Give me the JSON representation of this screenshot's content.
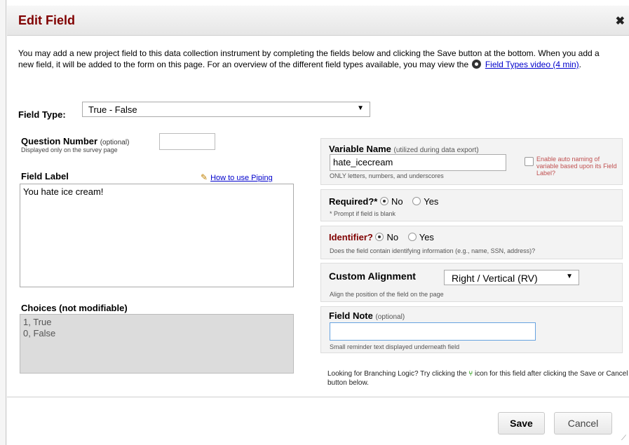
{
  "dialog": {
    "title": "Edit Field",
    "close_label": "✖"
  },
  "intro": {
    "text": "You may add a new project field to this data collection instrument by completing the fields below and clicking the Save button at the bottom. When you add a new field, it will be added to the form on this page. For an overview of the different field types available, you may view the",
    "link_label": "Field Types video (4 min)",
    "trailing": "."
  },
  "field_type": {
    "label": "Field Type:",
    "value": "True - False"
  },
  "question_number": {
    "label": "Question Number",
    "optional": "(optional)",
    "sub": "Displayed only on the survey page",
    "value": ""
  },
  "field_label": {
    "label": "Field Label",
    "piping_link": "How to use Piping",
    "value": "You hate ice cream!"
  },
  "choices": {
    "label": "Choices (not modifiable)",
    "lines": [
      "1, True",
      "0, False"
    ]
  },
  "variable_name": {
    "label": "Variable Name",
    "hint": "(utilized during data export)",
    "value": "hate_icecream",
    "sub": "ONLY letters, numbers, and underscores",
    "auto_naming": "Enable auto naming of variable based upon its Field Label?"
  },
  "required": {
    "label": "Required?*",
    "options": [
      "No",
      "Yes"
    ],
    "selected": "No",
    "sub": "* Prompt if field is blank"
  },
  "identifier": {
    "label": "Identifier?",
    "options": [
      "No",
      "Yes"
    ],
    "selected": "No",
    "sub": "Does the field contain identifying information (e.g., name, SSN, address)?"
  },
  "alignment": {
    "label": "Custom Alignment",
    "value": "Right / Vertical (RV)",
    "sub": "Align the position of the field on the page"
  },
  "field_note": {
    "label": "Field Note",
    "optional": "(optional)",
    "value": "",
    "sub": "Small reminder text displayed underneath field"
  },
  "branching": {
    "before": "Looking for Branching Logic? Try clicking the",
    "after": "icon for this field after clicking the Save or Cancel button below."
  },
  "buttons": {
    "save": "Save",
    "cancel": "Cancel"
  },
  "colors": {
    "title": "#800000",
    "identifier_label": "#800000",
    "link": "#0000cc"
  }
}
